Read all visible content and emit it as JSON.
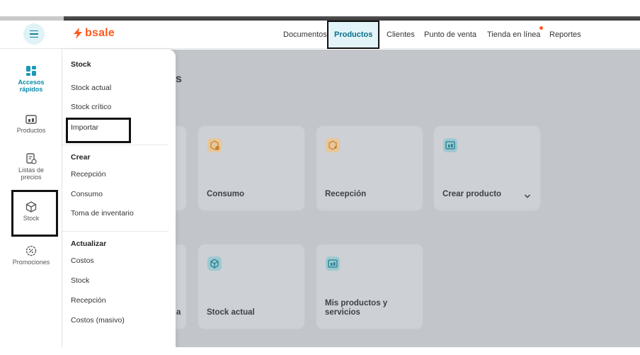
{
  "brand": {
    "name": "bsale",
    "accent": "#ff5a1f",
    "teal": "#0a8aa8"
  },
  "nav": {
    "items": [
      {
        "label": "Documentos"
      },
      {
        "label": "Productos",
        "active": true
      },
      {
        "label": "Clientes"
      },
      {
        "label": "Punto de venta"
      },
      {
        "label": "Tienda en línea",
        "notification": true
      },
      {
        "label": "Reportes"
      }
    ]
  },
  "sidebar": {
    "items": [
      {
        "label": "Accesos rápidos",
        "icon": "grid-icon",
        "active": true
      },
      {
        "label": "Productos",
        "icon": "products-icon"
      },
      {
        "label": "Listas de precios",
        "icon": "price-list-icon"
      },
      {
        "label": "Stock",
        "icon": "box-icon"
      },
      {
        "label": "Promociones",
        "icon": "promo-icon"
      }
    ]
  },
  "dropdown": {
    "sections": [
      {
        "title": "Stock",
        "items": [
          "Stock actual",
          "Stock crítico",
          "Importar"
        ]
      },
      {
        "title": "Crear",
        "items": [
          "Recepción",
          "Consumo",
          "Toma de inventario"
        ]
      },
      {
        "title": "Actualizar",
        "items": [
          "Costos",
          "Stock",
          "Recepción",
          "Costos (masivo)"
        ]
      }
    ]
  },
  "main": {
    "heading_partial": "s",
    "cards_row1": [
      {
        "title": "Consumo",
        "icon": "box-alert-icon",
        "color": "#e7a04a"
      },
      {
        "title": "Recepción",
        "icon": "box-add-icon",
        "color": "#e7a04a"
      },
      {
        "title": "Crear producto",
        "icon": "products-icon",
        "color": "#2b9cb0",
        "chevron": true
      }
    ],
    "cards_row2": [
      {
        "title": "a",
        "partial": true
      },
      {
        "title": "Stock actual",
        "icon": "box-icon",
        "color": "#2b9cb0"
      },
      {
        "title": "Mis productos y servicios",
        "icon": "products-icon",
        "color": "#2b9cb0"
      }
    ]
  }
}
